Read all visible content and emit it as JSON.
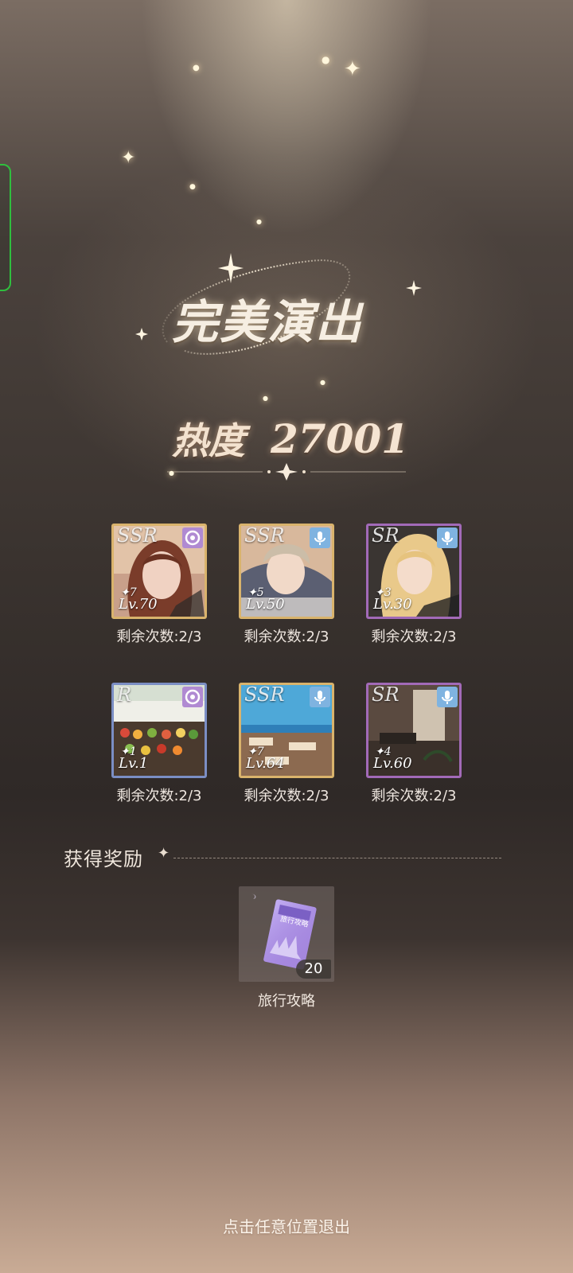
{
  "result": {
    "title": "完美演出",
    "heat_label": "热度",
    "heat_value": "27001"
  },
  "cards": [
    {
      "rarity": "SSR",
      "stars": "✦7",
      "level": "Lv.70",
      "type_icon": "vision-eye-icon",
      "remaining": "剩余次数:2/3",
      "frame_color": "#d9b36c"
    },
    {
      "rarity": "SSR",
      "stars": "✦5",
      "level": "Lv.50",
      "type_icon": "microphone-icon",
      "remaining": "剩余次数:2/3",
      "frame_color": "#d9b36c"
    },
    {
      "rarity": "SR",
      "stars": "✦3",
      "level": "Lv.30",
      "type_icon": "microphone-icon",
      "remaining": "剩余次数:2/3",
      "frame_color": "#a26ab8"
    },
    {
      "rarity": "R",
      "stars": "✦1",
      "level": "Lv.1",
      "type_icon": "vision-eye-icon",
      "remaining": "剩余次数:2/3",
      "frame_color": "#7b8ec4"
    },
    {
      "rarity": "SSR",
      "stars": "✦7",
      "level": "Lv.64",
      "type_icon": "microphone-icon",
      "remaining": "剩余次数:2/3",
      "frame_color": "#d9b36c"
    },
    {
      "rarity": "SR",
      "stars": "✦4",
      "level": "Lv.60",
      "type_icon": "microphone-icon",
      "remaining": "剩余次数:2/3",
      "frame_color": "#a26ab8"
    }
  ],
  "rewards": {
    "header": "获得奖励",
    "items": [
      {
        "name": "旅行攻略",
        "count": "20",
        "icon": "travel-guide-book-icon",
        "cover_text": "旅行攻略"
      }
    ]
  },
  "exit_hint": "点击任意位置退出"
}
